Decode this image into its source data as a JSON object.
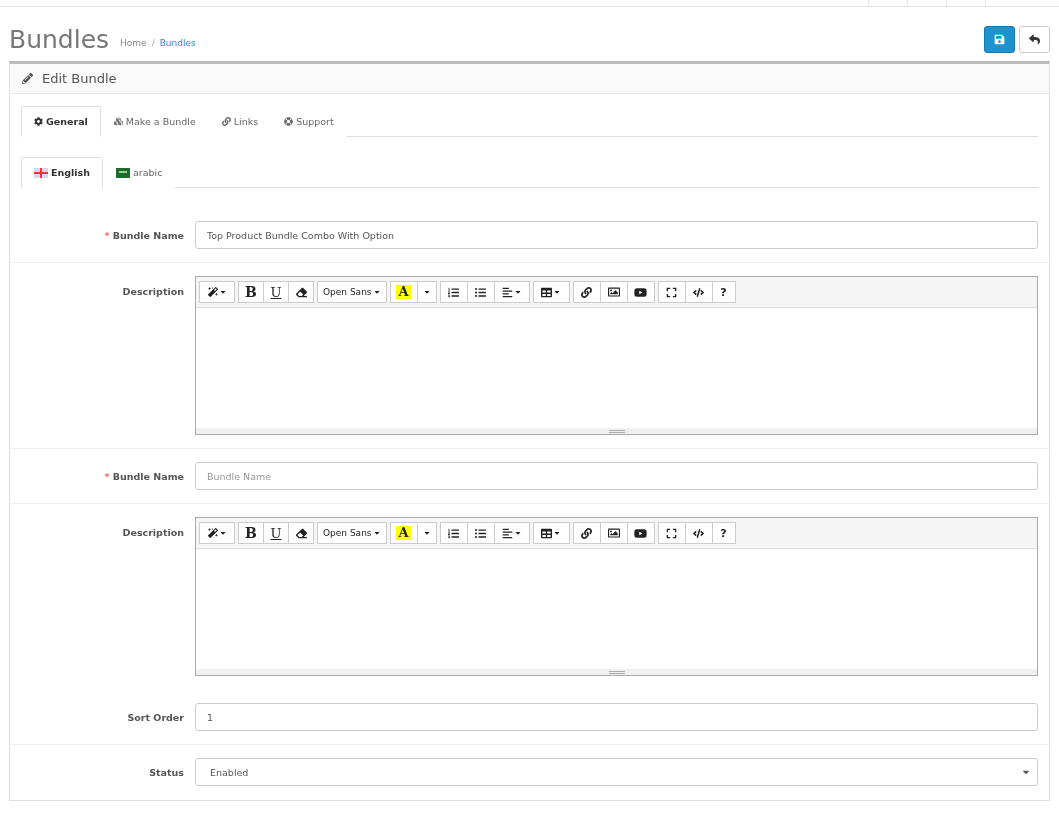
{
  "page": {
    "title": "Bundles",
    "breadcrumb_separator": "/",
    "breadcrumb": [
      {
        "label": "Home",
        "current": false
      },
      {
        "label": "Bundles",
        "current": true
      }
    ]
  },
  "panel": {
    "title": "Edit Bundle"
  },
  "tabs": [
    {
      "label": "General",
      "selected": true
    },
    {
      "label": "Make a Bundle",
      "selected": false
    },
    {
      "label": "Links",
      "selected": false
    },
    {
      "label": "Support",
      "selected": false
    }
  ],
  "languages": [
    {
      "label": "English",
      "selected": true
    },
    {
      "label": "arabic",
      "selected": false
    }
  ],
  "fields": [
    {
      "kind": "text",
      "label": "Bundle Name",
      "required_mark": "*",
      "value": "Top Product Bundle Combo With Option"
    },
    {
      "kind": "editor",
      "label": "Description",
      "toolbar": {
        "bold": "B",
        "underline": "U",
        "font": "Open Sans",
        "text_color_label": "A",
        "help": "?"
      }
    },
    {
      "kind": "text",
      "label": "Bundle Name",
      "required_mark": "*",
      "placeholder": "Bundle Name"
    },
    {
      "kind": "editor",
      "label": "Description",
      "toolbar": {
        "bold": "B",
        "underline": "U",
        "font": "Open Sans",
        "text_color_label": "A",
        "help": "?"
      }
    },
    {
      "kind": "text",
      "label": "Sort Order",
      "value": "1"
    },
    {
      "kind": "select",
      "label": "Status",
      "value": "Enabled"
    }
  ]
}
